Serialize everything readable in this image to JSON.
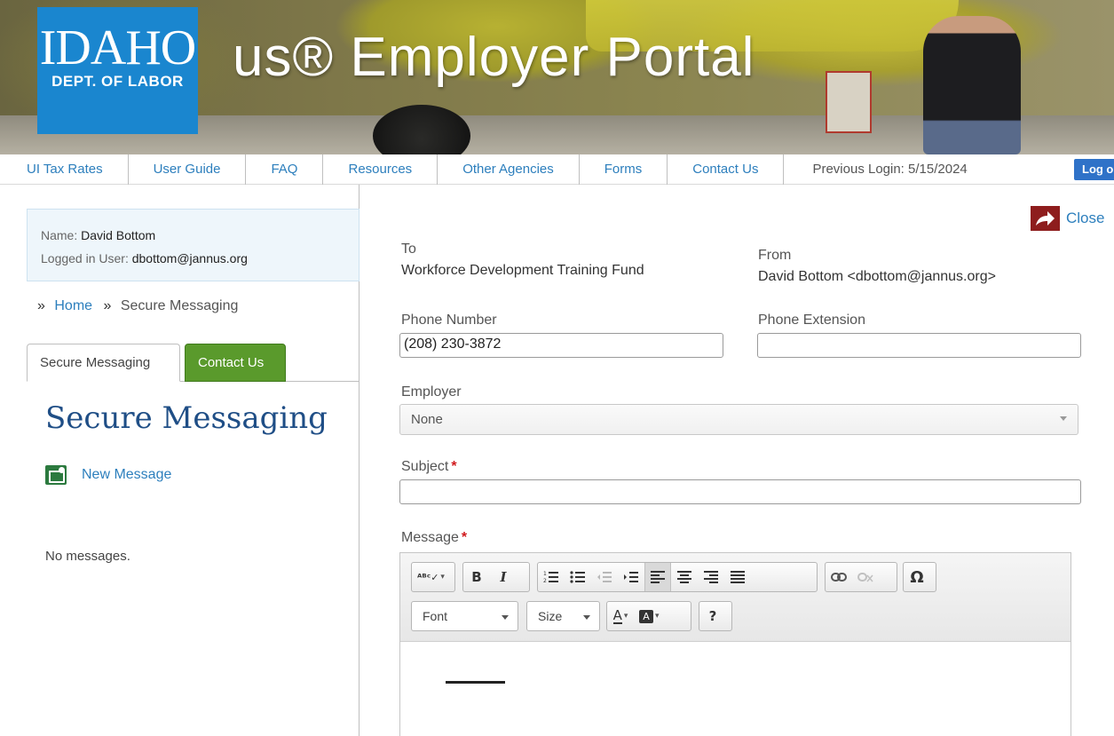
{
  "header": {
    "logo_line1": "IDAHO",
    "logo_line2": "DEPT. OF LABOR",
    "portal_title": "us® Employer Portal"
  },
  "topnav": {
    "links": [
      "UI Tax Rates",
      "User Guide",
      "FAQ",
      "Resources",
      "Other Agencies",
      "Forms",
      "Contact Us"
    ],
    "previous_login": "Previous Login: 5/15/2024",
    "logout_label": "Log o"
  },
  "user": {
    "name_label": "Name:",
    "name_value": "David Bottom",
    "logged_label": "Logged in User:",
    "logged_value": "dbottom@jannus.org"
  },
  "breadcrumb": {
    "sep": "»",
    "home": "Home",
    "current": "Secure Messaging"
  },
  "tabs": {
    "secure": "Secure Messaging",
    "contact": "Contact Us"
  },
  "sidebar": {
    "heading": "Secure Messaging",
    "new_message": "New Message",
    "empty": "No messages."
  },
  "form": {
    "close_label": "Close",
    "to_label": "To",
    "to_value": "Workforce Development Training Fund",
    "from_label": "From",
    "from_value": "David Bottom <dbottom@jannus.org>",
    "phone_label": "Phone Number",
    "phone_value": "(208) 230-3872",
    "ext_label": "Phone Extension",
    "ext_value": "",
    "employer_label": "Employer",
    "employer_value": "None",
    "subject_label": "Subject",
    "subject_value": "",
    "message_label": "Message",
    "required_mark": "*"
  },
  "editor": {
    "font_label": "Font",
    "size_label": "Size",
    "help_label": "?",
    "omega": "Ω"
  },
  "colors": {
    "link": "#2d7fbd",
    "logo_blue": "#1a86cf",
    "contact_tab_green": "#5a9a2c",
    "heading_navy": "#1f4e86",
    "required_red": "#d0191c",
    "close_icon_bg": "#8e1d1d"
  }
}
